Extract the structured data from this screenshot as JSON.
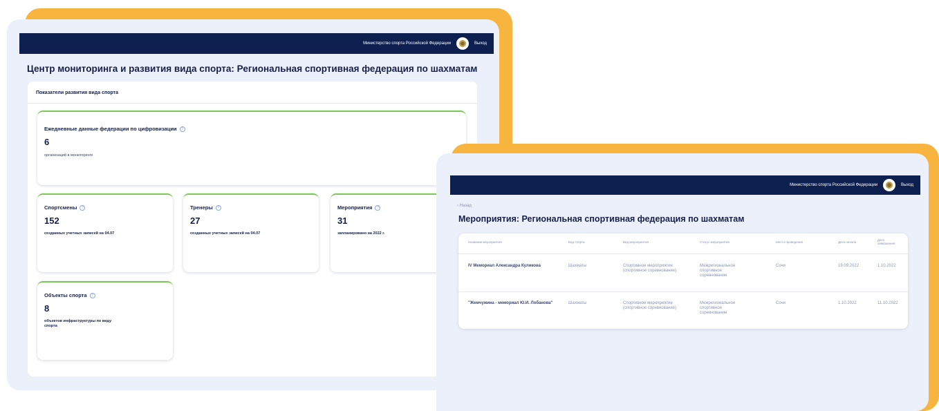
{
  "ministry_label": "Министерство спорта Российской Федерации",
  "logout_label": "Выход",
  "screen1": {
    "title": "Центр мониторинга и развития вида спорта: Региональная спортивная федерация по шахматам",
    "section_title": "Показатели развития вида спорта",
    "digital": {
      "title": "Ежедневные данные федерации по цифровизации",
      "value": "6",
      "desc": "организаций в мониторинге"
    },
    "athletes": {
      "title": "Спортсмены",
      "value": "152",
      "desc": "созданных учетных записей на 04.07"
    },
    "coaches": {
      "title": "Тренеры",
      "value": "27",
      "desc": "созданных учетных записей на 04.07"
    },
    "events": {
      "title": "Мероприятия",
      "value": "31",
      "desc": "запланировано на 2022 г."
    },
    "facilities": {
      "title": "Объекты спорта",
      "value": "8",
      "desc": "объектов инфраструктуры по виду спорта"
    }
  },
  "screen2": {
    "back_label": "‹ Назад",
    "title": "Мероприятия: Региональная спортивная федерация по шахматам",
    "columns": [
      "Название мероприятия",
      "Вид спорта",
      "Вид мероприятия",
      "Статус мероприятия",
      "Место проведения",
      "Дата начала",
      "Дата завершения"
    ],
    "rows": [
      {
        "name": "IV Мемориал Александра Куликова",
        "sport": "Шахматы",
        "type": "Спортивное мероприятие (спортивное соревнование)",
        "status": "Межрегиональное спортивное соревнование",
        "place": "Сочи",
        "start": "19.09.2022",
        "end": "1.10.2022"
      },
      {
        "name": "\"Жемчужина - мемориал Ю.И. Лобанова\"",
        "sport": "Шахматы",
        "type": "Спортивное мероприятие (спортивное соревнование)",
        "status": "Межрегиональное спортивное соревнование",
        "place": "Сочи",
        "start": "1.10.2022",
        "end": "11.10.2022"
      }
    ]
  },
  "colors": {
    "accent": "#f7b43e",
    "navy": "#0d1f4f",
    "panel": "#ecf0fa",
    "green": "#7cc85a"
  }
}
